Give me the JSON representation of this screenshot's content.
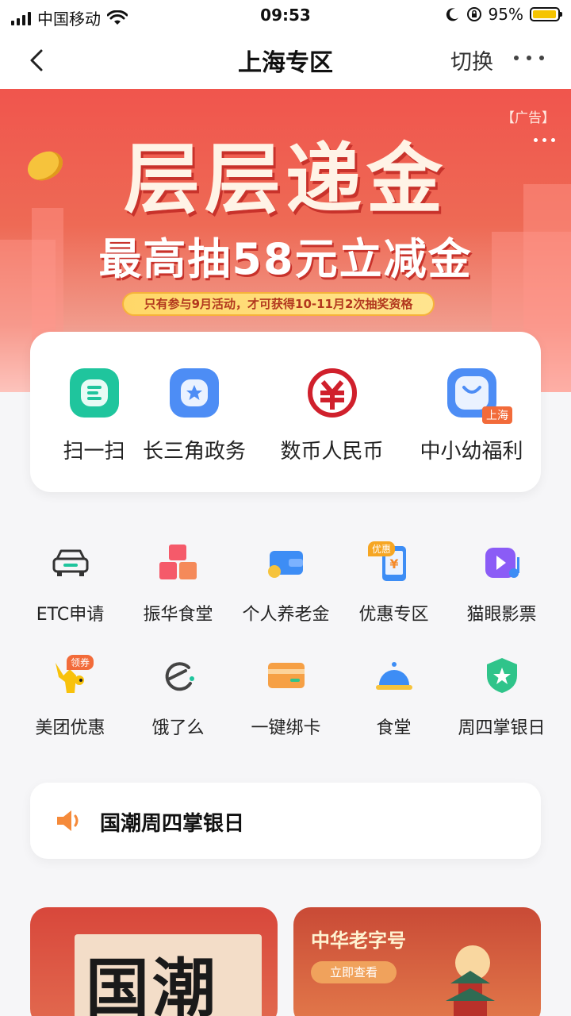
{
  "status_bar": {
    "carrier": "中国移动",
    "time": "09:53",
    "battery": "95%",
    "battery_level": 0.95
  },
  "nav": {
    "title": "上海专区",
    "switch_label": "切换"
  },
  "banner": {
    "ad_tag": "【广告】",
    "headline": "层层递金",
    "subline": "最高抽58元立减金",
    "note": "只有参与9月活动，才可获得10-11月2次抽奖资格"
  },
  "quick_actions": [
    {
      "label": "扫一扫",
      "icon": "scan-icon",
      "color": "#20c9a0"
    },
    {
      "label": "长三角政务",
      "icon": "gov-service-icon",
      "color": "#4f8ff7"
    },
    {
      "label": "数币人民币",
      "icon": "digital-rmb-icon",
      "color": "#d0202c"
    },
    {
      "label": "中小幼福利",
      "icon": "bag-icon",
      "color": "#4f8ff7",
      "badge": "上海"
    }
  ],
  "services": [
    {
      "label": "ETC申请",
      "icon": "car-icon"
    },
    {
      "label": "振华食堂",
      "icon": "blocks-icon"
    },
    {
      "label": "个人养老金",
      "icon": "wallet-icon"
    },
    {
      "label": "优惠专区",
      "icon": "phone-yuan-icon",
      "badge": "优惠"
    },
    {
      "label": "猫眼影票",
      "icon": "video-music-icon"
    },
    {
      "label": "美团优惠",
      "icon": "kangaroo-icon",
      "badge": "领券"
    },
    {
      "label": "饿了么",
      "icon": "eleme-icon"
    },
    {
      "label": "一键绑卡",
      "icon": "card-icon"
    },
    {
      "label": "食堂",
      "icon": "cloche-icon"
    },
    {
      "label": "周四掌银日",
      "icon": "shield-star-icon"
    }
  ],
  "announcement": {
    "text": "国潮周四掌银日",
    "icon": "speaker-icon"
  },
  "promos": [
    {
      "title": "国潮"
    },
    {
      "title": "中华老字号",
      "button": "立即查看"
    }
  ],
  "colors": {
    "brand_red": "#e8473d",
    "badge_orange": "#f26b3a"
  }
}
